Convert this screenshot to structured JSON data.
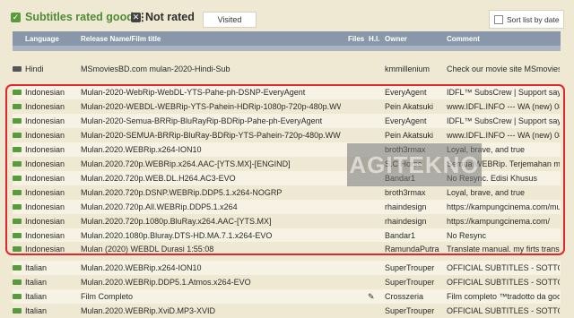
{
  "toolbar": {
    "rated_label": "Subtitles rated good",
    "not_rated_label": "Not rated",
    "visited_label": "Visited",
    "sort_label": "Sort list by date"
  },
  "columns": [
    "Language",
    "Release Name/Film title",
    "Files",
    "H.I.",
    "Owner",
    "Comment"
  ],
  "rows": [
    {
      "lang": "Hindi",
      "name": "MSmoviesBD.com mulan-2020-Hindi-Sub",
      "owner": "kmmillenium",
      "comment": "Check our movie site MSmoviesB...",
      "icon": "gray"
    },
    {
      "lang": "Indonesian",
      "name": "Mulan-2020-WebRip-WebDL-YTS-Pahe-ph-DSNP-EveryAgent",
      "owner": "EveryAgent",
      "comment": "IDFL™ SubsCrew | Support saya di",
      "icon": "green"
    },
    {
      "lang": "Indonesian",
      "name": "Mulan-2020-WEBDL-WEBRip-YTS-Pahein-HDRip-1080p-720p-480p.WWW.IDF",
      "owner": "Pein Akatsuki",
      "comment": "www.IDFL.INFO --- WA (new) 088 1",
      "icon": "green"
    },
    {
      "lang": "Indonesian",
      "name": "Mulan-2020-Semua-BRRip-BluRayRip-BDRip-Pahe-ph-EveryAgent",
      "owner": "EveryAgent",
      "comment": "IDFL™ SubsCrew | Support saya di",
      "icon": "green"
    },
    {
      "lang": "Indonesian",
      "name": "Mulan-2020-SEMUA-BRRip-BluRay-BDRip-YTS-Pahein-720p-480p.WWW.IDFL",
      "owner": "Pein Akatsuki",
      "comment": "www.IDFL.INFO --- WA (new) 088 1",
      "icon": "green"
    },
    {
      "lang": "Indonesian",
      "name": "Mulan.2020.WEBRip.x264-ION10",
      "owner": "broth3rmax",
      "comment": "Loyal, brave, and true",
      "icon": "green"
    },
    {
      "lang": "Indonesian",
      "name": "Mulan.2020.720p.WEBRip.x264.AAC-[YTS.MX]-[ENGIND]",
      "owner": "S.C Horse",
      "comment": "Semua WEBRip. Terjemahan makny",
      "icon": "green"
    },
    {
      "lang": "Indonesian",
      "name": "Mulan.2020.720p.WEB.DL.H264.AC3-EVO",
      "owner": "Bandar1",
      "comment": "No Resync. Edisi Khusus",
      "icon": "green"
    },
    {
      "lang": "Indonesian",
      "name": "Mulan.2020.720p.DSNP.WEBRip.DDP5.1.x264-NOGRP",
      "owner": "broth3rmax",
      "comment": "Loyal, brave, and true",
      "icon": "green"
    },
    {
      "lang": "Indonesian",
      "name": "Mulan.2020.720p.All.WEBRip.DDP5.1.x264",
      "owner": "rhaindesign",
      "comment": "https://kampungcinema.com/mula",
      "icon": "green"
    },
    {
      "lang": "Indonesian",
      "name": "Mulan.2020.720p.1080p.BluRay.x264.AAC-[YTS.MX]",
      "owner": "rhaindesign",
      "comment": "https://kampungcinema.com/",
      "icon": "green"
    },
    {
      "lang": "Indonesian",
      "name": "Mulan.2020.1080p.Bluray.DTS-HD.MA.7.1.x264-EVO",
      "owner": "Bandar1",
      "comment": "No Resync",
      "icon": "green"
    },
    {
      "lang": "Indonesian",
      "name": "Mulan (2020) WEBDL Durasi 1:55:08",
      "owner": "RamundaPutra",
      "comment": "Translate manual. my firts translatio",
      "icon": "green"
    },
    {
      "lang": "Italian",
      "name": "Mulan.2020.WEBRip.x264-ION10",
      "owner": "SuperTrouper",
      "comment": "OFFICIAL SUBTITLES - SOTTOTIT",
      "icon": "green"
    },
    {
      "lang": "Italian",
      "name": "Mulan.2020.WEBRip.DDP5.1.Atmos.x264-EVO",
      "owner": "SuperTrouper",
      "comment": "OFFICIAL SUBTITLES - SOTTOTIT",
      "icon": "green"
    },
    {
      "lang": "Italian",
      "name": "Film Completo",
      "owner": "Crosszeria",
      "comment": "Film completo ™tradotto da google",
      "icon": "green",
      "flag": true
    },
    {
      "lang": "Italian",
      "name": "Mulan.2020.WEBRip.XviD.MP3-XVID",
      "owner": "SuperTrouper",
      "comment": "OFFICIAL SUBTITLES - SOTTOTIT",
      "icon": "green"
    }
  ],
  "watermark": "AGITEKNO",
  "colors": {
    "accent_green": "#5a9a3e",
    "header": "#8898aa",
    "highlight": "#e0282a"
  }
}
